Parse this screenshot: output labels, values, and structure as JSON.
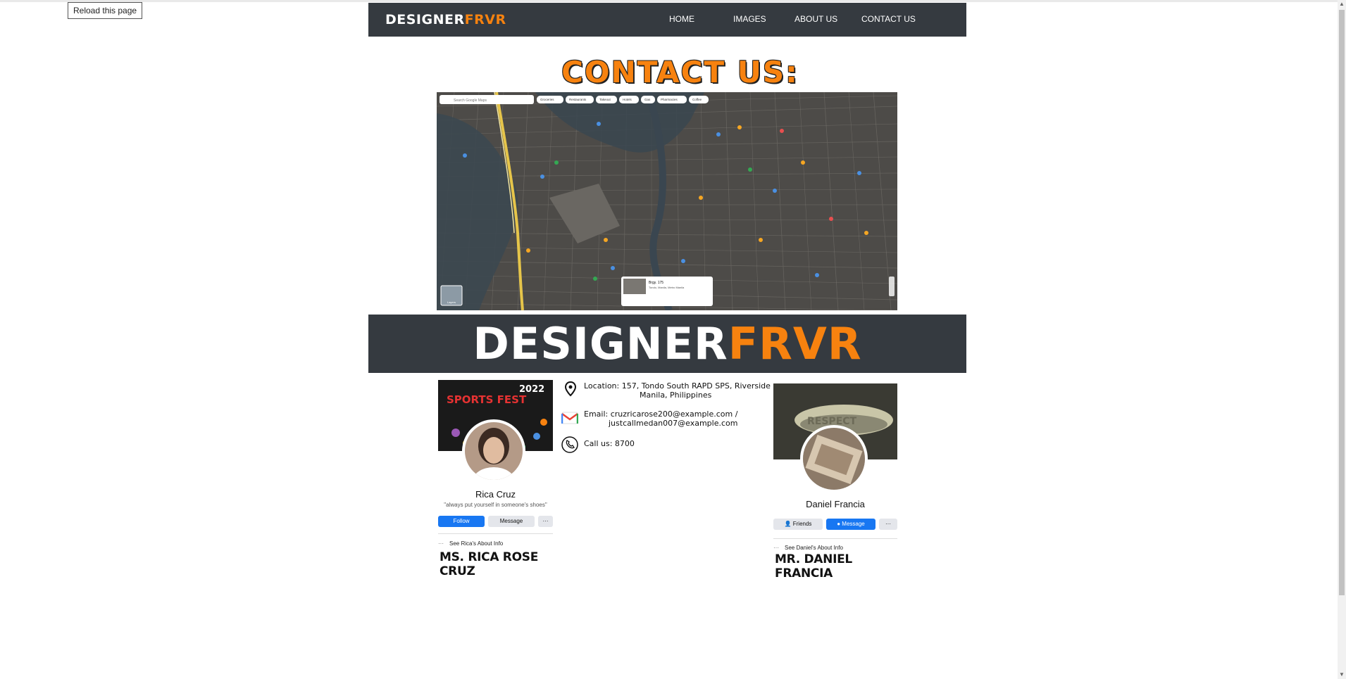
{
  "browser": {
    "reload_label": "Reload this page"
  },
  "nav": {
    "logo_white": "DESIGNER",
    "logo_orange": "FRVR",
    "links": [
      "HOME",
      "IMAGES",
      "ABOUT US",
      "CONTACT US"
    ]
  },
  "page": {
    "title": "CONTACT US:"
  },
  "map": {
    "search_placeholder": "Search Google Maps",
    "chips": [
      "Groceries",
      "Restaurants",
      "Takeout",
      "Hotels",
      "Gas",
      "Pharmacies",
      "Coffee"
    ],
    "place": {
      "name": "Brgy. 175",
      "address": "Tondo, Manila, Metro Manila"
    },
    "layers_label": "Layers"
  },
  "banner": {
    "logo_white": "DESIGNER",
    "logo_orange": "FRVR"
  },
  "contact": {
    "location": [
      "Location: 157, Tondo South RAPD SPS, Riverside",
      "Manila, Philippines"
    ],
    "email": [
      "Email: cruzricarose200@example.com /",
      "justcallmedan007@example.com"
    ],
    "phone": "Call us: 8700"
  },
  "left_card": {
    "cover_year": "2022",
    "cover_title": "SPORTS FEST",
    "name": "Rica Cruz",
    "quote": "\"always put yourself in someone's shoes\"",
    "follow_label": "Follow",
    "message_label": "Message",
    "more_label": "···",
    "about_label": "See Rica's About Info",
    "full_name": "MS. RICA ROSE CRUZ"
  },
  "right_card": {
    "cover_text": "RESPECT",
    "name": "Daniel Francia",
    "friends_label": "Friends",
    "message_label": "Message",
    "more_label": "···",
    "about_label": "See Daniel's About Info",
    "full_name": "MR. DANIEL FRANCIA"
  },
  "colors": {
    "navbar": "#353a40",
    "accent": "#f7820f",
    "fb_blue": "#1877f2"
  }
}
